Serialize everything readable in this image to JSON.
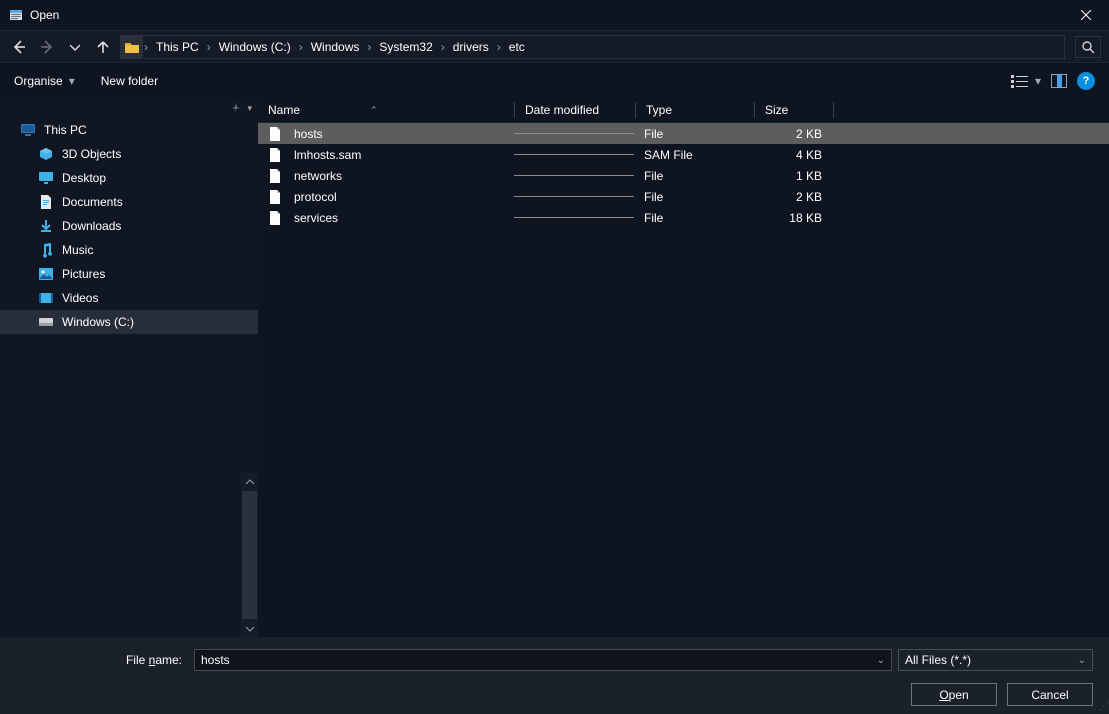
{
  "window": {
    "title": "Open"
  },
  "breadcrumb": [
    "This PC",
    "Windows (C:)",
    "Windows",
    "System32",
    "drivers",
    "etc"
  ],
  "toolbar": {
    "organise": "Organise",
    "newfolder": "New folder"
  },
  "sidebar": {
    "root": "This PC",
    "items": [
      {
        "label": "3D Objects",
        "icon": "cube",
        "c": "#3fb1e6"
      },
      {
        "label": "Desktop",
        "icon": "desktop",
        "c": "#3fb1e6"
      },
      {
        "label": "Documents",
        "icon": "doc",
        "c": "#3fb1e6"
      },
      {
        "label": "Downloads",
        "icon": "down",
        "c": "#3fb1e6"
      },
      {
        "label": "Music",
        "icon": "music",
        "c": "#3fb1e6"
      },
      {
        "label": "Pictures",
        "icon": "pic",
        "c": "#3fb1e6"
      },
      {
        "label": "Videos",
        "icon": "vid",
        "c": "#3fb1e6"
      },
      {
        "label": "Windows (C:)",
        "icon": "drive",
        "c": "#cfd3d8",
        "sel": true
      }
    ]
  },
  "columns": {
    "name": "Name",
    "modified": "Date modified",
    "type": "Type",
    "size": "Size"
  },
  "files": [
    {
      "name": "hosts",
      "type": "File",
      "size": "2 KB",
      "sel": true
    },
    {
      "name": "lmhosts.sam",
      "type": "SAM File",
      "size": "4 KB"
    },
    {
      "name": "networks",
      "type": "File",
      "size": "1 KB"
    },
    {
      "name": "protocol",
      "type": "File",
      "size": "2 KB"
    },
    {
      "name": "services",
      "type": "File",
      "size": "18 KB"
    }
  ],
  "footer": {
    "filename_label_pre": "File ",
    "filename_label_u": "n",
    "filename_label_post": "ame:",
    "filename_value": "hosts",
    "filter": "All Files  (*.*)",
    "open_u": "O",
    "open_post": "pen",
    "cancel": "Cancel"
  }
}
